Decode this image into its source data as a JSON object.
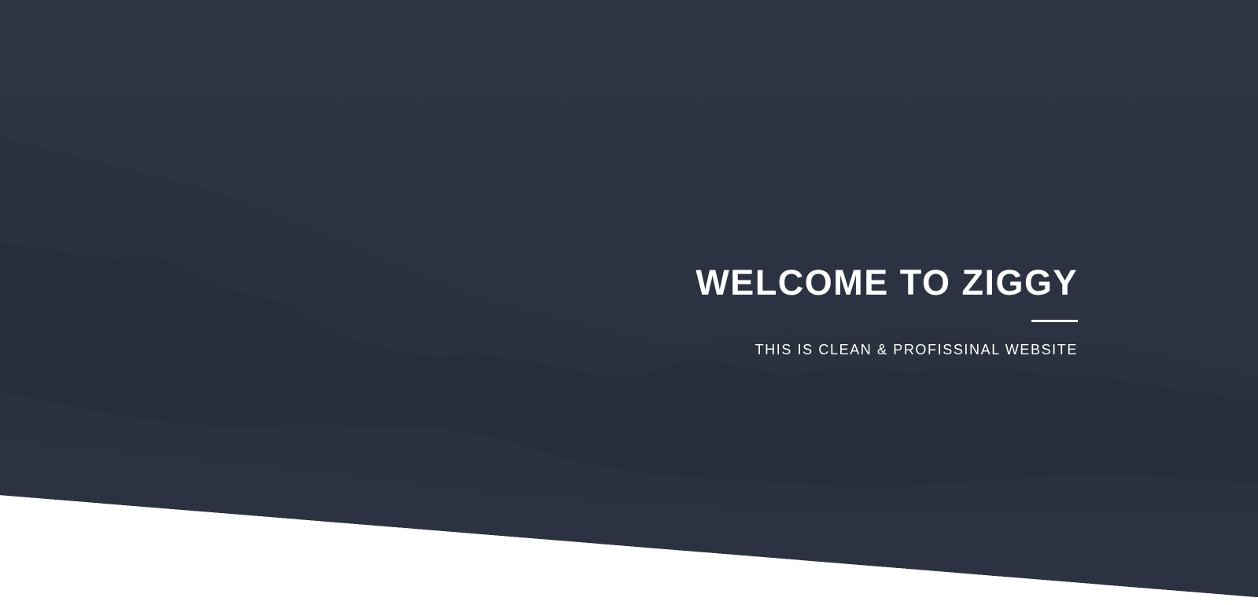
{
  "hero": {
    "title": "WELCOME TO ZIGGY",
    "subtitle": "THIS IS CLEAN & PROFISSINAL WEBSITE"
  },
  "colors": {
    "overlay": "#2d3342",
    "text": "#ffffff",
    "page_background": "#ffffff"
  }
}
